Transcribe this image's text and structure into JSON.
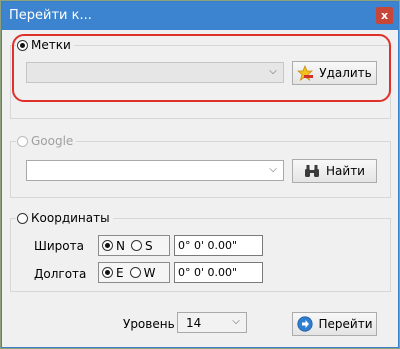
{
  "window": {
    "title": "Перейти к...",
    "close_glyph": "x"
  },
  "bookmarks": {
    "radio_label": "Метки",
    "combo_value": "",
    "delete_button": "Удалить",
    "delete_icon": "star-minus-icon"
  },
  "google": {
    "radio_label": "Google",
    "search_value": "",
    "find_button": "Найти",
    "find_icon": "binoculars-icon"
  },
  "coordinates": {
    "radio_label": "Координаты",
    "latitude_label": "Широта",
    "longitude_label": "Долгота",
    "lat_n": "N",
    "lat_s": "S",
    "lon_e": "E",
    "lon_w": "W",
    "lat_value": "0° 0' 0.00\"",
    "lon_value": "0° 0' 0.00\""
  },
  "footer": {
    "level_label": "Уровень",
    "level_value": "14",
    "go_button": "Перейти",
    "go_icon": "arrow-right-circle-icon"
  },
  "colors": {
    "titlebar": "#3c84cf",
    "highlight": "#e0302b",
    "close": "#c7463a"
  }
}
